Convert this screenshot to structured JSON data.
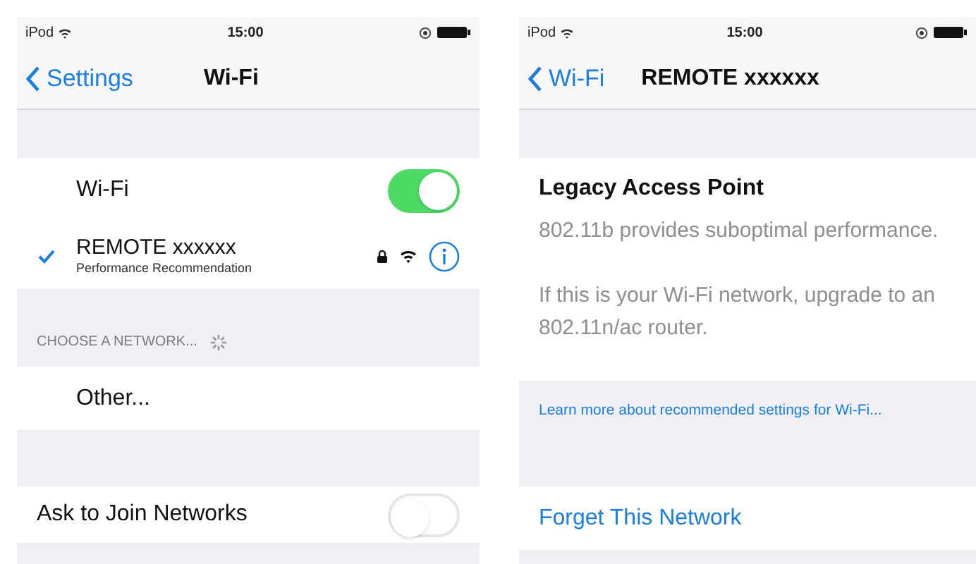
{
  "left_screen": {
    "status_bar": {
      "carrier": "iPod",
      "time": "15:00"
    },
    "nav": {
      "back": "Settings",
      "title": "Wi-Fi"
    },
    "wifi_row": {
      "label": "Wi-Fi",
      "on": true
    },
    "connected_network": {
      "name": "REMOTE xxxxxx",
      "subtitle": "Performance Recommendation",
      "selected": true
    },
    "section_header": {
      "label": "CHOOSE A NETWORK..."
    },
    "other_row": {
      "label": "Other..."
    },
    "ask_row": {
      "label": "Ask to Join Networks",
      "on": false
    }
  },
  "right_screen": {
    "status_bar": {
      "carrier": "iPod",
      "time": "15:00"
    },
    "nav": {
      "back": "Wi-Fi",
      "title": "REMOTE xxxxxx"
    },
    "notice": {
      "title": "Legacy Access Point",
      "paragraphs": [
        "802.11b provides suboptimal performance.",
        "If this is your Wi-Fi network, upgrade to an 802.11n/ac router."
      ]
    },
    "link": "Learn more about recommended settings for Wi-Fi...",
    "forget_button": "Forget This Network"
  }
}
